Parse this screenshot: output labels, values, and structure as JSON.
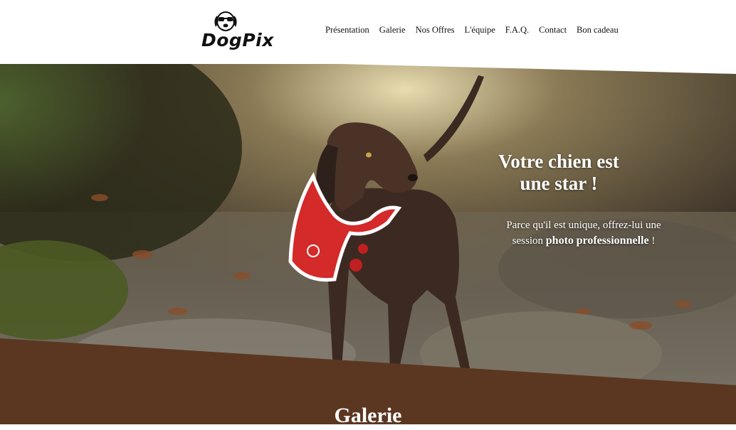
{
  "brand": {
    "name": "DogPix"
  },
  "nav": {
    "items": [
      "Présentation",
      "Galerie",
      "Nos Offres",
      "L'équipe",
      "F.A.Q.",
      "Contact",
      "Bon cadeau"
    ]
  },
  "hero": {
    "title_line1": "Votre chien est",
    "title_line2": "une star !",
    "sub_plain1": "Parce qu'il est unique, offrez-lui une session ",
    "sub_bold1": "photo",
    "sub_bold2": "professionnelle",
    "sub_end": " !"
  },
  "gallery": {
    "title": "Galerie"
  },
  "colors": {
    "brown": "#5b3721",
    "white": "#ffffff",
    "text": "#111111"
  }
}
